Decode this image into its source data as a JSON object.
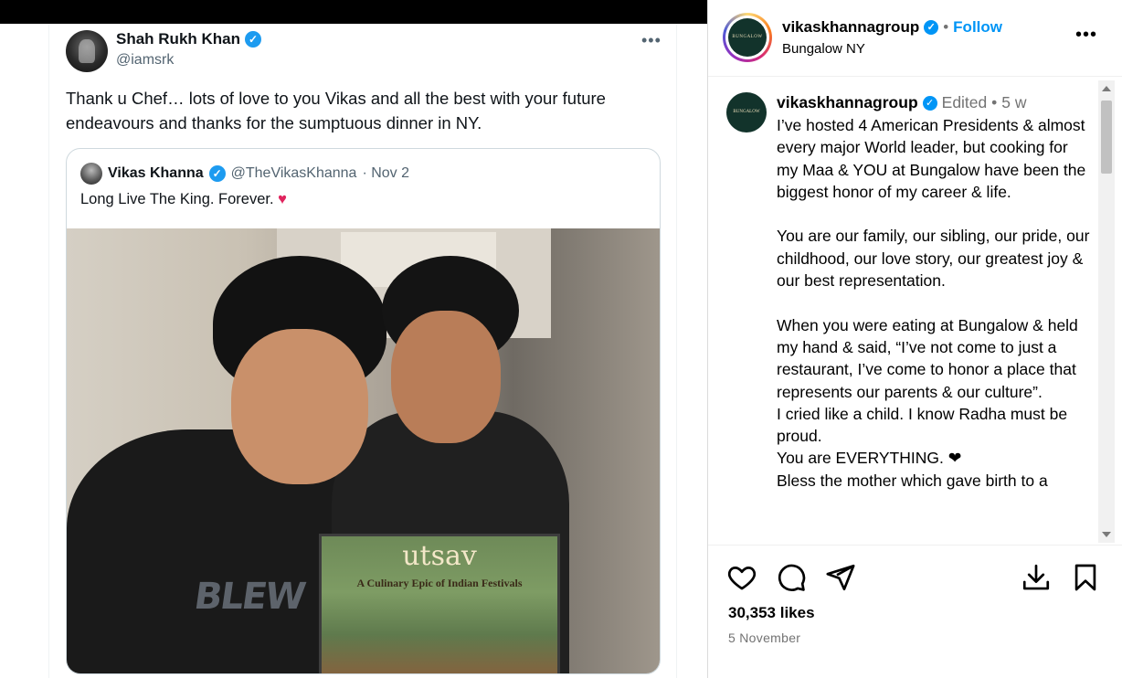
{
  "tweet": {
    "author_name": "Shah Rukh Khan",
    "author_handle": "@iamsrk",
    "more": "•••",
    "text": "Thank u Chef… lots of love to you Vikas and all the best with your future endeavours and thanks for the sumptuous dinner in NY.",
    "quote": {
      "author_name": "Vikas Khanna",
      "author_handle": "@TheVikasKhanna",
      "date": "· Nov 2",
      "text": "Long Live The King. Forever.",
      "heart": "♥",
      "book_title": "utsav",
      "book_subtitle": "A Culinary Epic of Indian Festivals",
      "shirt_print": "BLEW"
    }
  },
  "instagram": {
    "header": {
      "username": "vikaskhannagroup",
      "follow_label": "Follow",
      "location": "Bungalow NY",
      "more": "•••",
      "logo_text": "BUNGALOW"
    },
    "caption": {
      "username": "vikaskhannagroup",
      "edited": "Edited •",
      "age": "5 w",
      "body": "I’ve hosted 4 American Presidents & almost every major World leader, but cooking for my Maa & YOU at Bungalow have been the biggest honor of my career & life.\n\nYou are our family, our sibling, our pride, our childhood, our love story, our greatest joy & our best representation.\n\nWhen you were eating at Bungalow & held my hand & said, “I’ve not come to just a restaurant, I’ve come to honor a place that represents our parents & our culture”.\nI cried like a child. I know Radha must be proud.\nYou are EVERYTHING. ❤\nBless the mother which gave birth to a"
    },
    "likes": "30,353 likes",
    "date": "5 November"
  }
}
